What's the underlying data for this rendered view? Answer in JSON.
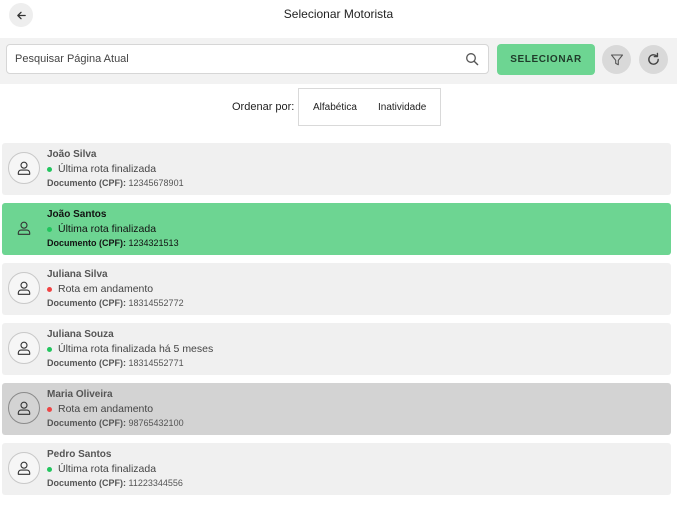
{
  "header": {
    "title": "Selecionar Motorista"
  },
  "search": {
    "placeholder": "Pesquisar Página Atual"
  },
  "toolbar": {
    "select_label": "SELECIONAR"
  },
  "sort": {
    "label": "Ordenar por:",
    "options": [
      "Alfabética",
      "Inatividade"
    ]
  },
  "document_label": "Documento (CPF):",
  "status_colors": {
    "finalized": "#22c55e",
    "in_progress": "#ef4444"
  },
  "colors": {
    "accent": "#6dd592",
    "card": "#f0f0f0",
    "card_inactive": "#d3d3d3"
  },
  "drivers": [
    {
      "name": "João Silva",
      "status": "Última rota finalizada",
      "status_type": "finalized",
      "cpf": "12345678901",
      "state": "normal"
    },
    {
      "name": "João Santos",
      "status": "Última rota finalizada",
      "status_type": "finalized",
      "cpf": "1234321513",
      "state": "selected"
    },
    {
      "name": "Juliana Silva",
      "status": "Rota em andamento",
      "status_type": "in_progress",
      "cpf": "18314552772",
      "state": "normal"
    },
    {
      "name": "Juliana Souza",
      "status": "Última rota finalizada há 5 meses",
      "status_type": "finalized",
      "cpf": "18314552771",
      "state": "normal"
    },
    {
      "name": "Maria Oliveira",
      "status": "Rota em andamento",
      "status_type": "in_progress",
      "cpf": "98765432100",
      "state": "inactive"
    },
    {
      "name": "Pedro Santos",
      "status": "Última rota finalizada",
      "status_type": "finalized",
      "cpf": "11223344556",
      "state": "normal"
    }
  ]
}
